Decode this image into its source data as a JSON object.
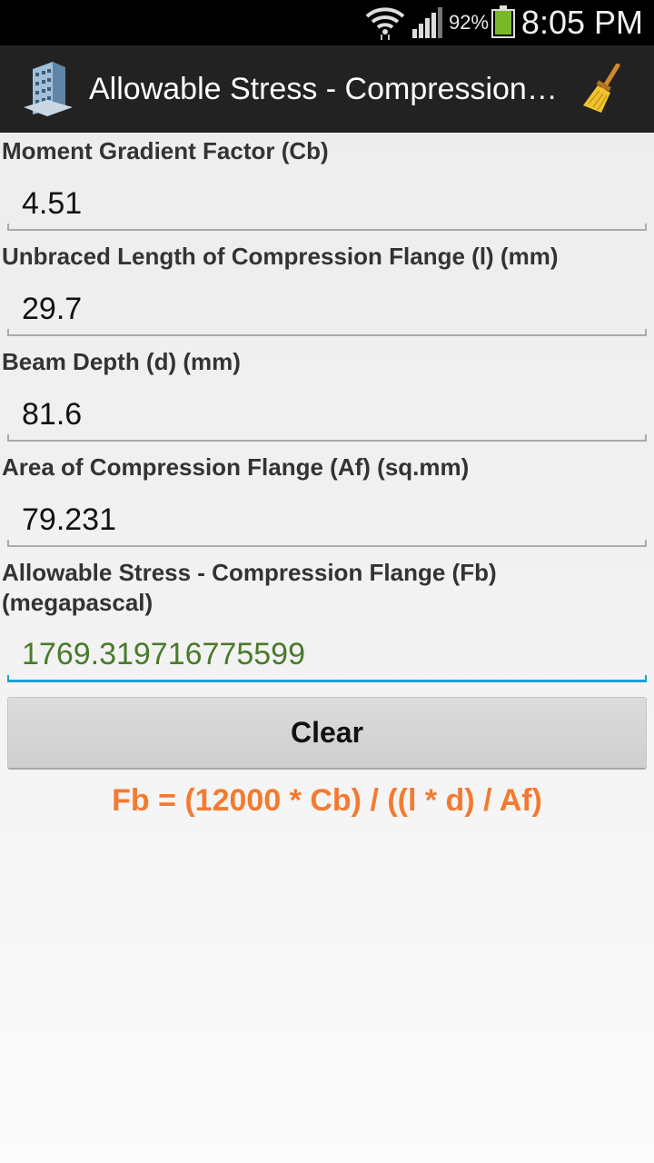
{
  "status_bar": {
    "battery_percent": "92%",
    "time": "8:05 PM",
    "icons": [
      "wifi-icon",
      "signal-icon",
      "battery-icon"
    ]
  },
  "action_bar": {
    "title": "Allowable Stress - Compression Flange",
    "app_icon": "building-icon",
    "action_icon": "broom-icon"
  },
  "fields": [
    {
      "label": "Moment Gradient Factor (Cb)",
      "value": "4.51"
    },
    {
      "label": "Unbraced Length of Compression Flange (l) (mm)",
      "value": "29.7"
    },
    {
      "label": "Beam Depth (d) (mm)",
      "value": "81.6"
    },
    {
      "label": "Area of Compression Flange (Af) (sq.mm)",
      "value": "79.231"
    }
  ],
  "result": {
    "label_line1": "Allowable Stress - Compression Flange (Fb)",
    "label_line2": "(megapascal)",
    "value": "1769.319716775599"
  },
  "clear_button": "Clear",
  "formula": "Fb = (12000 * Cb) / ((l * d) / Af)",
  "colors": {
    "action_bar": "#222222",
    "formula": "#f47a30",
    "result_text": "#4a7a2a",
    "focus_underline": "#1ea0d2"
  }
}
